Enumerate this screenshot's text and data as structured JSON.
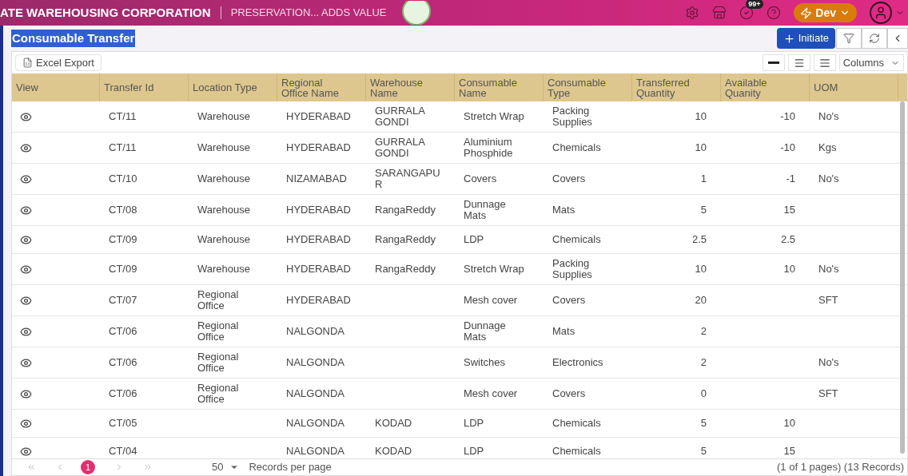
{
  "header": {
    "org": "ATE WAREHOUSING CORPORATION",
    "tagline": "PRESERVATION... ADDS VALUE",
    "notification_count": "99+",
    "environment": "Dev"
  },
  "page": {
    "title": "Consumable Transfer",
    "initiate": "Initiate"
  },
  "toolbar": {
    "export": "Excel Export",
    "columns": "Columns"
  },
  "table": {
    "columns": [
      "View",
      "Transfer Id",
      "Location Type",
      "Regional Office Name",
      "Warehouse Name",
      "Consumable Name",
      "Consumable Type",
      "Transferred Quantity",
      "Available Quanity",
      "UOM"
    ],
    "rows": [
      [
        "",
        "CT/11",
        "Warehouse",
        "HYDERABAD",
        "GURRALA GONDI",
        "Stretch Wrap",
        "Packing Supplies",
        "10",
        "-10",
        "No's"
      ],
      [
        "",
        "CT/11",
        "Warehouse",
        "HYDERABAD",
        "GURRALA GONDI",
        "Aluminium Phosphide",
        "Chemicals",
        "10",
        "-10",
        "Kgs"
      ],
      [
        "",
        "CT/10",
        "Warehouse",
        "NIZAMABAD",
        "SARANGAPUR",
        "Covers",
        "Covers",
        "1",
        "-1",
        "No's"
      ],
      [
        "",
        "CT/08",
        "Warehouse",
        "HYDERABAD",
        "RangaReddy",
        "Dunnage Mats",
        "Mats",
        "5",
        "15",
        ""
      ],
      [
        "",
        "CT/09",
        "Warehouse",
        "HYDERABAD",
        "RangaReddy",
        "LDP",
        "Chemicals",
        "2.5",
        "2.5",
        ""
      ],
      [
        "",
        "CT/09",
        "Warehouse",
        "HYDERABAD",
        "RangaReddy",
        "Stretch Wrap",
        "Packing Supplies",
        "10",
        "10",
        "No's"
      ],
      [
        "",
        "CT/07",
        "Regional Office",
        "HYDERABAD",
        "",
        "Mesh cover",
        "Covers",
        "20",
        "",
        "SFT"
      ],
      [
        "",
        "CT/06",
        "Regional Office",
        "NALGONDA",
        "",
        "Dunnage Mats",
        "Mats",
        "2",
        "",
        ""
      ],
      [
        "",
        "CT/06",
        "Regional Office",
        "NALGONDA",
        "",
        "Switches",
        "Electronics",
        "2",
        "",
        "No's"
      ],
      [
        "",
        "CT/06",
        "Regional Office",
        "NALGONDA",
        "",
        "Mesh cover",
        "Covers",
        "0",
        "",
        "SFT"
      ],
      [
        "",
        "CT/05",
        "",
        "NALGONDA",
        "KODAD",
        "LDP",
        "Chemicals",
        "5",
        "10",
        ""
      ],
      [
        "",
        "CT/04",
        "",
        "NALGONDA",
        "KODAD",
        "LDP",
        "Chemicals",
        "5",
        "15",
        ""
      ]
    ]
  },
  "pagination": {
    "pages": [
      {
        "label": "1",
        "selected": true
      }
    ],
    "page_size": "50",
    "page_size_label": "Records per page",
    "summary": "(1 of 1 pages) (13 Records)"
  }
}
